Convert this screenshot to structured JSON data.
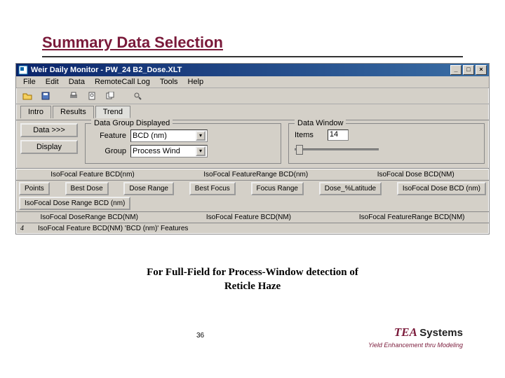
{
  "slide": {
    "title": "Summary Data Selection",
    "caption_line1": "For Full-Field for Process-Window detection of",
    "caption_line2": "Reticle Haze",
    "page_number": "36",
    "brand_prefix": "TEA",
    "brand_suffix": "Systems",
    "brand_sub": "Yield Enhancement thru Modeling"
  },
  "window": {
    "title": "Weir Daily Monitor - PW_24 B2_Dose.XLT",
    "syscontrols": {
      "minimize": "_",
      "maximize": "□",
      "close": "×"
    },
    "menu": {
      "file": "File",
      "edit": "Edit",
      "data": "Data",
      "remotecall": "RemoteCall Log",
      "tools": "Tools",
      "help": "Help"
    },
    "tabs": {
      "intro": "Intro",
      "results": "Results",
      "trend": "Trend"
    },
    "panel_buttons": {
      "data": "Data >>>",
      "display": "Display"
    },
    "data_group": {
      "legend": "Data Group Displayed",
      "feature_label": "Feature",
      "feature_value": "BCD (nm)",
      "group_label": "Group",
      "group_value": "Process Wind"
    },
    "data_window": {
      "legend": "Data Window",
      "items_label": "Items",
      "items_value": "14"
    },
    "row1_buttons": [
      "Points",
      "Best Dose",
      "Dose Range",
      "Best Focus",
      "Focus Range",
      "Dose_%Latitude",
      "IsoFocal Dose BCD (nm)",
      "IsoFocal Dose Range BCD (nm)"
    ],
    "row1_headers": [
      "IsoFocal Feature BCD(nm)",
      "IsoFocal FeatureRange BCD(nm)",
      "IsoFocal Dose BCD(NM)"
    ],
    "row2": [
      "IsoFocal DoseRange BCD(NM)",
      "IsoFocal Feature BCD(NM)",
      "IsoFocal FeatureRange BCD(NM)"
    ],
    "status_prefix": "4",
    "status": "IsoFocal Feature BCD(NM) 'BCD (nm)' Features"
  }
}
